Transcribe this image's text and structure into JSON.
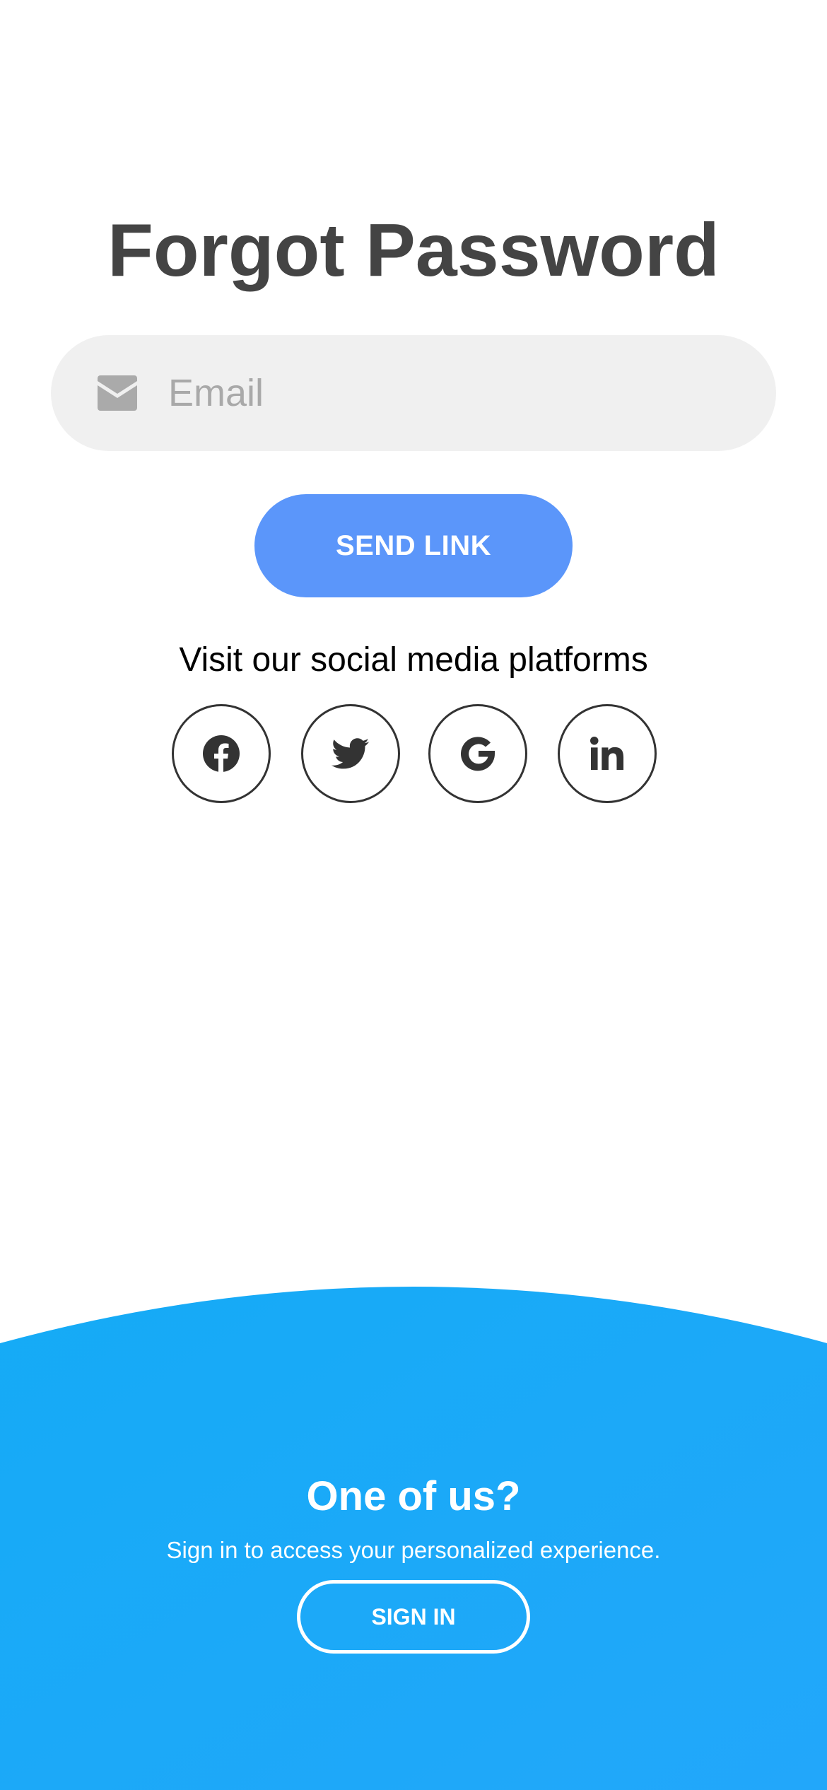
{
  "form": {
    "title": "Forgot Password",
    "email_placeholder": "Email",
    "email_value": "",
    "email_icon": "envelope-icon",
    "submit_label": "SEND LINK"
  },
  "social": {
    "heading": "Visit our social media platforms",
    "links": [
      {
        "icon": "facebook-icon"
      },
      {
        "icon": "twitter-icon"
      },
      {
        "icon": "google-icon"
      },
      {
        "icon": "linkedin-icon"
      }
    ]
  },
  "panel": {
    "title": "One of us?",
    "subtitle": "Sign in to access your personalized experience.",
    "signin_label": "SIGN IN"
  },
  "colors": {
    "title_text": "#444444",
    "input_bg": "#f0f0f0",
    "primary_button": "#5b96fa",
    "panel_gradient_start": "#15abf6",
    "panel_gradient_end": "#22a7fa",
    "social_icon": "#333333"
  }
}
